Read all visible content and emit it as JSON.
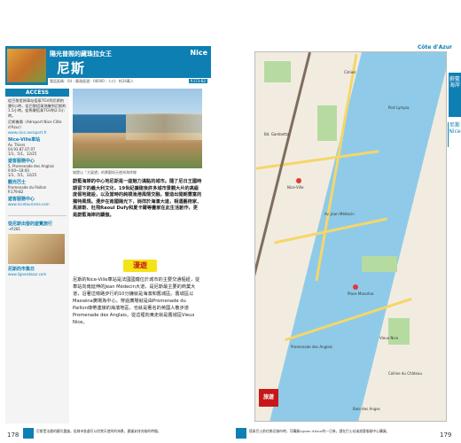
{
  "header": {
    "tagline": "陽光普照的藏珠拉女王",
    "title": "尼斯",
    "title_en": "Nice",
    "info": "電話區碼：04｜郵政區號：06000｜人口：約34萬人",
    "map_ref": "P.173-B2"
  },
  "sidebar": {
    "access_label": "ACCESS",
    "access_text": [
      "從巴黎里昂車站搭乘TGV到尼斯約需6小時，從巴黎搭乘飛機到尼斯約1.5小時。從馬賽搭乘TGV約2.5小時。",
      "尼斯機場（Aéroport Nice Côte d'Azur）",
      "www.nice.aeroport.fr"
    ],
    "blocks": [
      {
        "title": "Nice-Ville車站",
        "lines": [
          "Av. Thiers",
          "04.93.87.07.07",
          "1/1、5/1、12/25"
        ]
      },
      {
        "title": "遊客服務中心",
        "lines": [
          "5, Promenade des Anglais",
          "9:00~18:00",
          "1/1、5/1、12/25"
        ]
      },
      {
        "title": "觀光巴士",
        "lines": [
          "Promenade du Paillon",
          "P.179-B2"
        ]
      },
      {
        "title": "遊客服務中心",
        "lines": [
          "www.nicetourisme.com"
        ]
      }
    ],
    "tip_title": "從尼斯出發的遊覽旅行",
    "tip_ref": "→P.281",
    "tip2_title": "尼斯的市集日",
    "tip2_url": "www.lignesdazur.com"
  },
  "intro": "蔚藍海岸的中心地尼斯是一座魅力滿點的城市。隨了尼日王國時期留下的義大利文化，19世紀擴建後許多城市景觀大片的高級度假地建設，以及當時的純樸漁港風情交融，營造出開朗豐富的獨特風情。漫步在南國陽光下，徜徉於海濱大道，相遇藝術家、馬諦斯、杜飛Raoul Dufy和夏卡爾等畫家在此生活創作，更是蔚藍海岸的驕傲。",
  "photo_caption": "城堡山「大展望」的景觀與天使灣海岸線",
  "section_label": "漫遊",
  "body_text": "尼斯的Nice-Ville車站是法國國鐵位於城市的主要交通樞紐，從車站向南延伸的Jean Médecin大道，是尼斯最主要的商業大道，沿著這條路步行約10分鐘就是海濱和舊城區。舊城區以Masséna廣場為中心，穿過廣場就是由Promenade du Paillon綠帶連接的海濱地區，也就是著名的英國人散步道Promenade des Anglais，從這裡向東走就是舊城區Vieux Nice。",
  "left_page_number": "178",
  "left_footnote": "尼斯是法國的觀光重鎮，從城市各處可以欣賞天使灣的海景，建議安排充裕的時間。",
  "right_page_number": "179",
  "right_footnote": "搭乘巴士前往鄰近城市時，可購買Lignes d'Azur的一日券，請在巴士站或遊客服務中心購買。",
  "region_label": "Côte d'Azur",
  "right_tab": "蔚藍海岸",
  "right_tab2": "尼斯Nice",
  "map": {
    "badge": "旅遊",
    "labels": [
      "Nice-Ville",
      "Bd. Gambetta",
      "Av. Jean Médecin",
      "Place Masséna",
      "Vieux Nice",
      "Promenade des Anglais",
      "Port Lympia",
      "Colline du Château",
      "Cimiez",
      "Baie des Anges"
    ]
  }
}
